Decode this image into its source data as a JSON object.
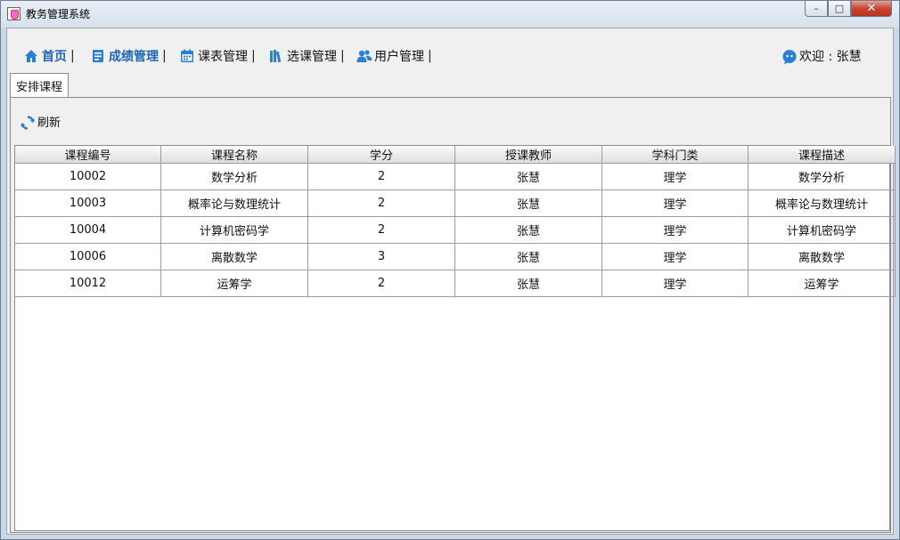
{
  "window": {
    "title": "教务管理系统",
    "controls": {
      "minimize": "–",
      "maximize": "□",
      "close": "✕"
    }
  },
  "menu": {
    "items": [
      {
        "label": "首页",
        "icon": "home-icon",
        "active": true
      },
      {
        "label": "成绩管理",
        "icon": "document-icon",
        "active": true
      },
      {
        "label": "课表管理",
        "icon": "calendar-icon",
        "active": false
      },
      {
        "label": "选课管理",
        "icon": "books-icon",
        "active": false
      },
      {
        "label": "用户管理",
        "icon": "users-icon",
        "active": false
      }
    ],
    "separator": "|",
    "welcome": "欢迎 : 张慧",
    "welcome_icon": "chat-avatar-icon"
  },
  "tab": {
    "label": "安排课程"
  },
  "toolbar": {
    "refresh_label": "刷新",
    "refresh_icon": "refresh-icon"
  },
  "table": {
    "columns": [
      "课程编号",
      "课程名称",
      "学分",
      "授课教师",
      "学科门类",
      "课程描述"
    ],
    "rows": [
      [
        "10002",
        "数学分析",
        "2",
        "张慧",
        "理学",
        "数学分析"
      ],
      [
        "10003",
        "概率论与数理统计",
        "2",
        "张慧",
        "理学",
        "概率论与数理统计"
      ],
      [
        "10004",
        "计算机密码学",
        "2",
        "张慧",
        "理学",
        "计算机密码学"
      ],
      [
        "10006",
        "离散数学",
        "3",
        "张慧",
        "理学",
        "离散数学"
      ],
      [
        "10012",
        "运筹学",
        "2",
        "张慧",
        "理学",
        "运筹学"
      ]
    ]
  },
  "colors": {
    "accent": "#1f66b7",
    "icon_blue": "#2a7fd0"
  }
}
